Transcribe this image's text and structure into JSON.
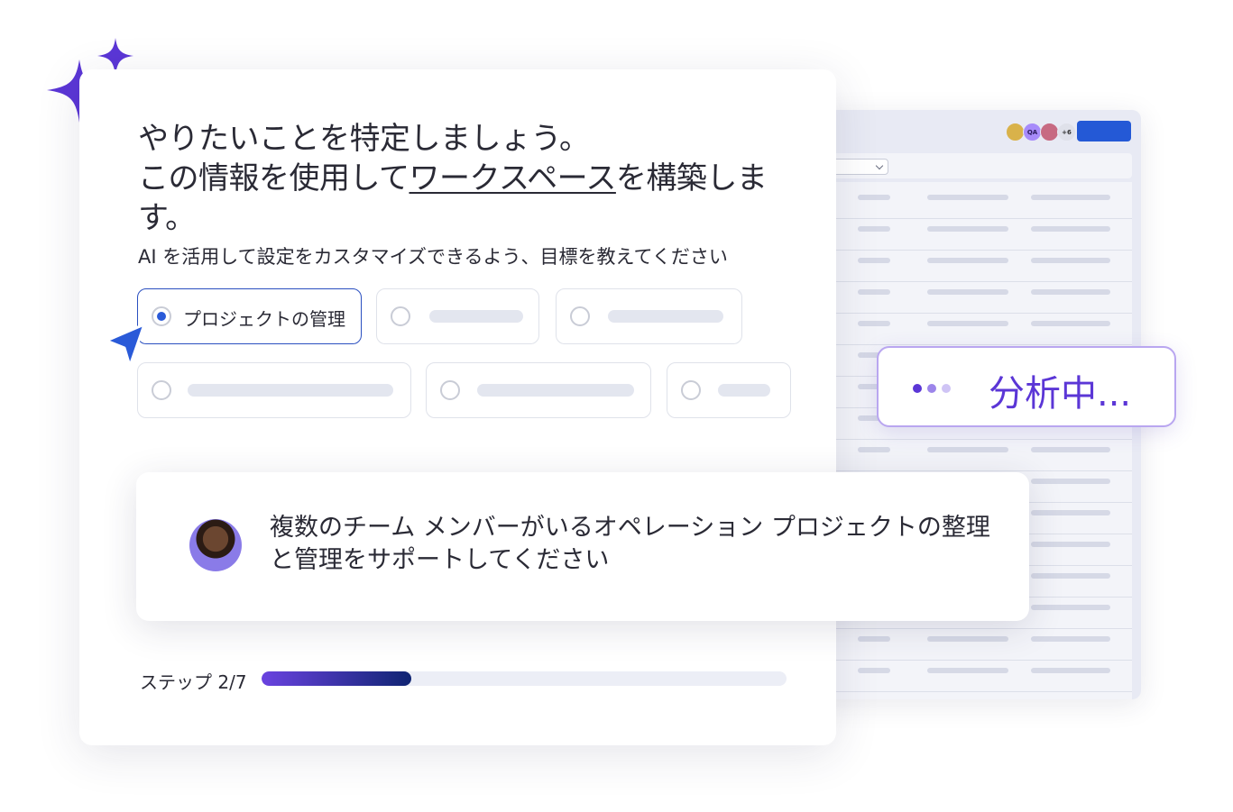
{
  "heading": {
    "line1": "やりたいことを特定しましょう。",
    "line2_before": "この情報を使用して",
    "line2_link": "ワークスペース",
    "line2_after": "を構築します。"
  },
  "subtitle": "AI を活用して設定をカスタマイズできるよう、目標を教えてください",
  "options": {
    "selected_label": "プロジェクトの管理"
  },
  "chat": {
    "message": "複数のチーム メンバーがいるオペレーション プロジェクトの整理と管理をサポートしてください"
  },
  "progress": {
    "label": "ステップ 2/7",
    "current": 2,
    "total": 7,
    "fraction": 0.2857
  },
  "status": {
    "text": "分析中..."
  },
  "workspace": {
    "avatars": [
      "",
      "QA",
      "",
      "+6"
    ]
  },
  "colors": {
    "accent": "#2a5ad8",
    "purple": "#5b36d6",
    "progress_start": "#6a43e0",
    "progress_end": "#0f2472"
  },
  "icons": [
    "sparkle-icon",
    "cursor-arrow-icon"
  ]
}
